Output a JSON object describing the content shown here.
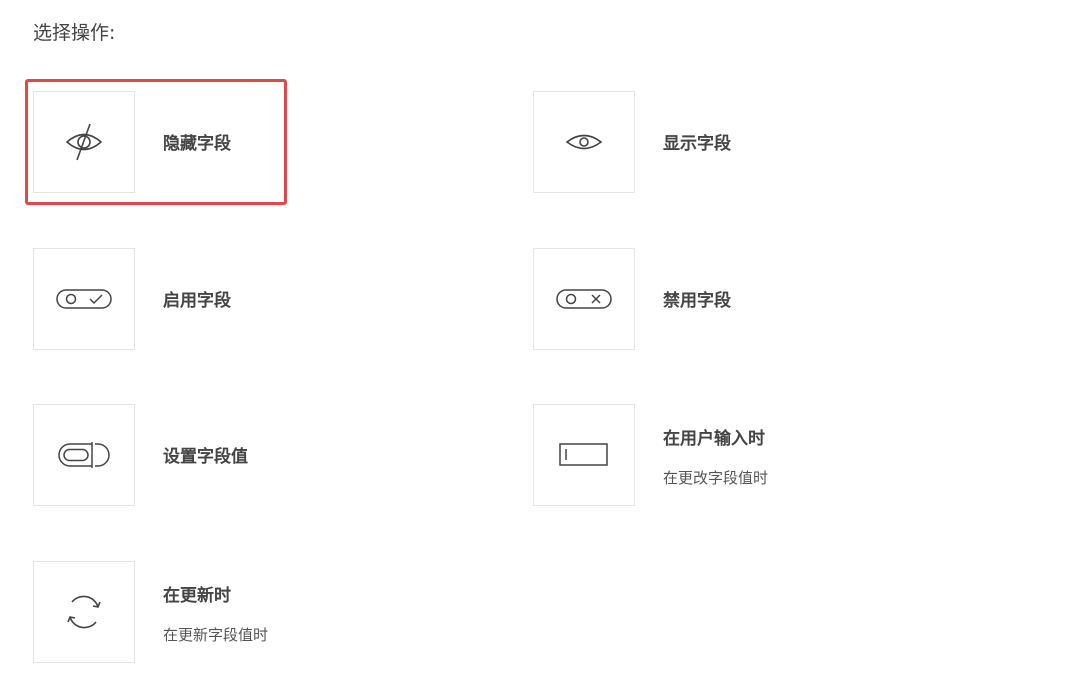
{
  "header": {
    "title": "选择操作:"
  },
  "options": [
    {
      "id": "hide-field",
      "icon": "eye-slash-icon",
      "label": "隐藏字段",
      "sublabel": "",
      "selected": true
    },
    {
      "id": "show-field",
      "icon": "eye-icon",
      "label": "显示字段",
      "sublabel": "",
      "selected": false
    },
    {
      "id": "enable-field",
      "icon": "toggle-check-icon",
      "label": "启用字段",
      "sublabel": "",
      "selected": false
    },
    {
      "id": "disable-field",
      "icon": "toggle-x-icon",
      "label": "禁用字段",
      "sublabel": "",
      "selected": false
    },
    {
      "id": "set-field-value",
      "icon": "input-value-icon",
      "label": "设置字段值",
      "sublabel": "",
      "selected": false
    },
    {
      "id": "on-user-input",
      "icon": "text-cursor-box-icon",
      "label": "在用户输入时",
      "sublabel": "在更改字段值时",
      "selected": false
    },
    {
      "id": "on-update",
      "icon": "refresh-icon",
      "label": "在更新时",
      "sublabel": "在更新字段值时",
      "selected": false
    }
  ],
  "colors": {
    "selected_border": "#e24848",
    "icon_stroke": "#444444",
    "box_border": "#e4e4e4"
  }
}
